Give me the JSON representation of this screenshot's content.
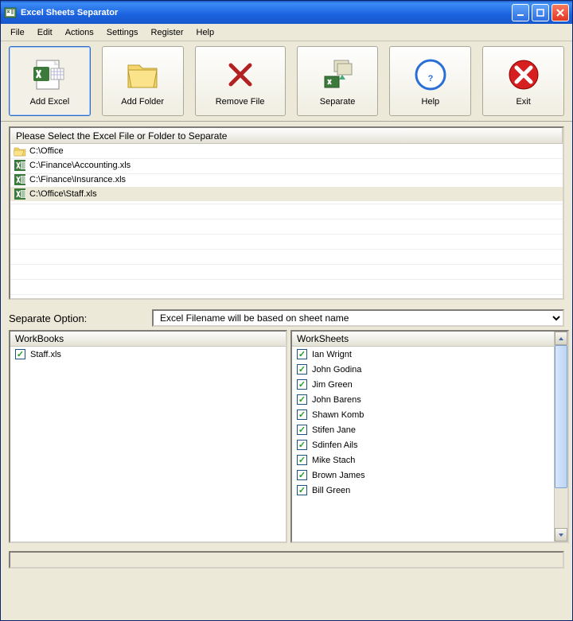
{
  "window": {
    "title": "Excel Sheets Separator"
  },
  "menubar": {
    "items": [
      "File",
      "Edit",
      "Actions",
      "Settings",
      "Register",
      "Help"
    ]
  },
  "toolbar": {
    "add_excel": "Add Excel",
    "add_folder": "Add Folder",
    "remove_file": "Remove File",
    "separate": "Separate",
    "help": "Help",
    "exit": "Exit"
  },
  "filelist": {
    "header": "Please Select the Excel File or Folder to Separate",
    "rows": [
      {
        "type": "folder",
        "path": "C:\\Office"
      },
      {
        "type": "excel",
        "path": "C:\\Finance\\Accounting.xls"
      },
      {
        "type": "excel",
        "path": "C:\\Finance\\Insurance.xls"
      },
      {
        "type": "excel",
        "path": "C:\\Office\\Staff.xls",
        "selected": true
      }
    ]
  },
  "separate_option": {
    "label": "Separate Option:",
    "value": "Excel Filename will be based on sheet name"
  },
  "workbooks": {
    "header": "WorkBooks",
    "items": [
      {
        "name": "Staff.xls",
        "checked": true
      }
    ]
  },
  "worksheets": {
    "header": "WorkSheets",
    "items": [
      {
        "name": "Ian Wrignt",
        "checked": true
      },
      {
        "name": "John Godina",
        "checked": true
      },
      {
        "name": "Jim Green",
        "checked": true
      },
      {
        "name": "John Barens",
        "checked": true
      },
      {
        "name": "Shawn Komb",
        "checked": true
      },
      {
        "name": "Stifen Jane",
        "checked": true
      },
      {
        "name": "Sdinfen Ails",
        "checked": true
      },
      {
        "name": "Mike Stach",
        "checked": true
      },
      {
        "name": "Brown James",
        "checked": true
      },
      {
        "name": "Bill Green",
        "checked": true
      }
    ]
  }
}
